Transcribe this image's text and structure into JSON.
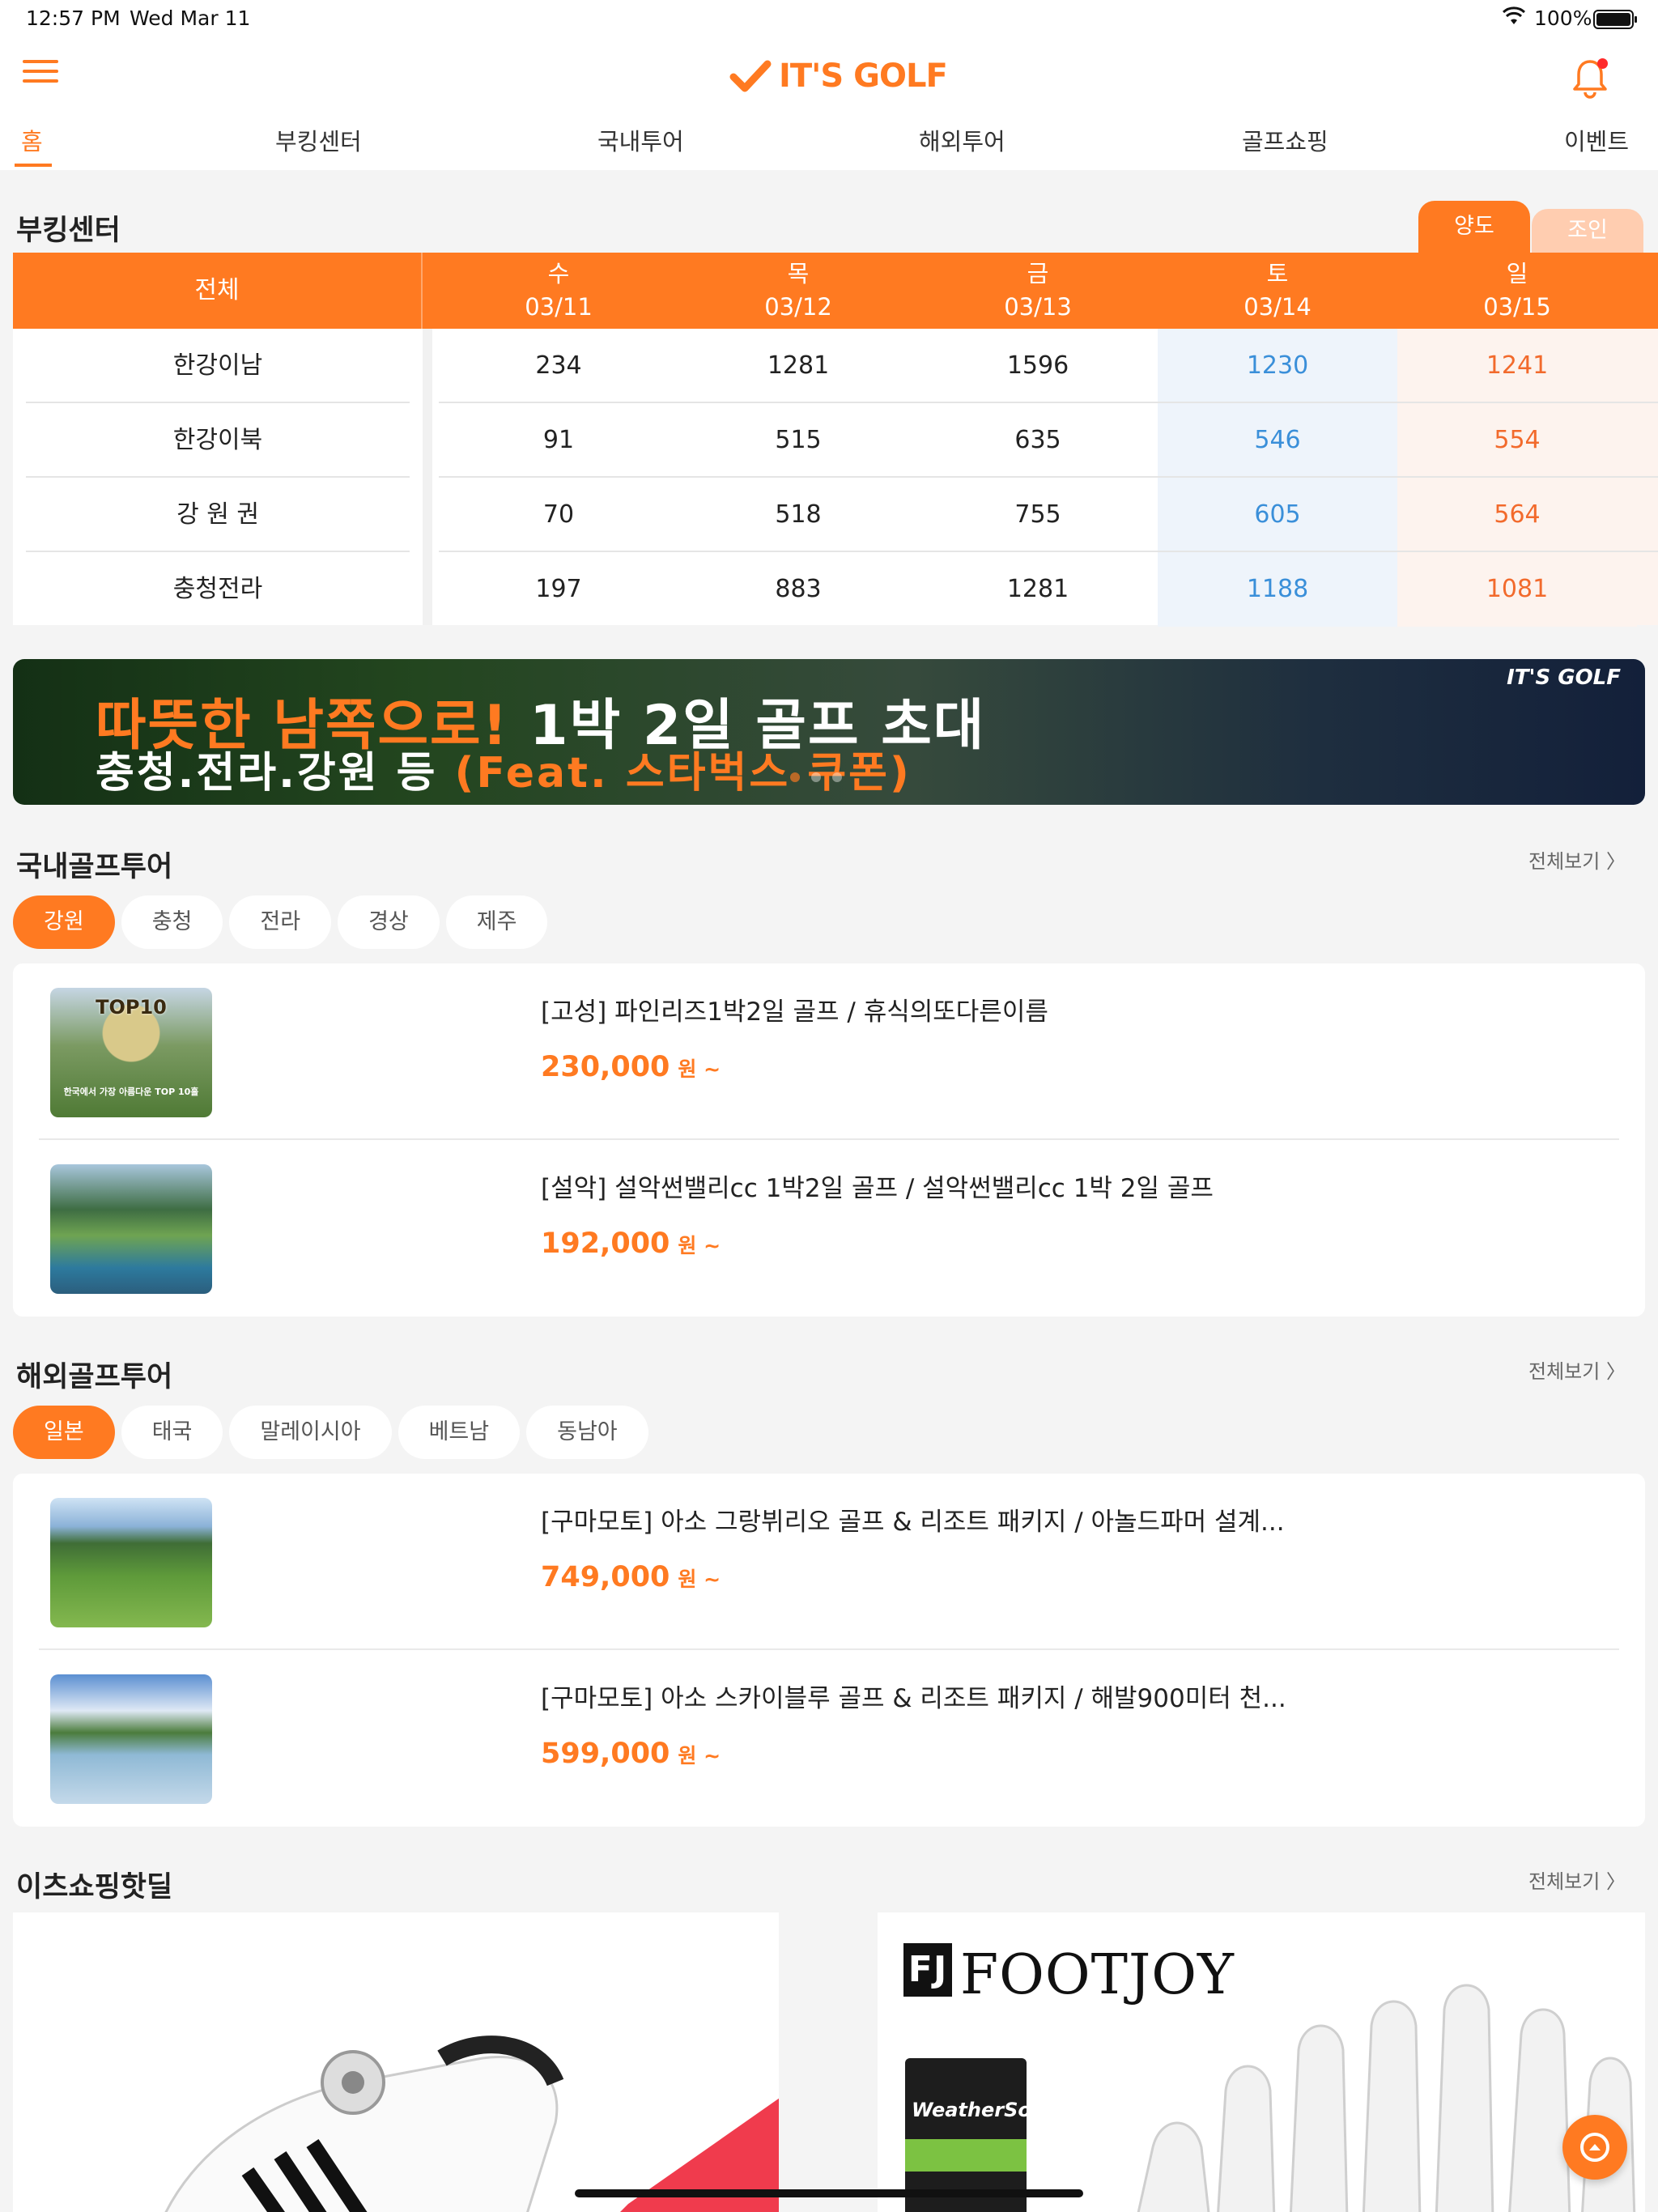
{
  "status_bar": {
    "time": "12:57 PM",
    "date": "Wed Mar 11",
    "battery": "100%"
  },
  "header": {
    "logo": "IT'S GOLF"
  },
  "nav": {
    "tabs": [
      "홈",
      "부킹센터",
      "국내투어",
      "해외투어",
      "골프쇼핑",
      "이벤트"
    ]
  },
  "booking": {
    "title": "부킹센터",
    "toggle": [
      "양도",
      "조인"
    ],
    "all_label": "전체",
    "days": [
      {
        "dow": "수",
        "date": "03/11"
      },
      {
        "dow": "목",
        "date": "03/12"
      },
      {
        "dow": "금",
        "date": "03/13"
      },
      {
        "dow": "토",
        "date": "03/14"
      },
      {
        "dow": "일",
        "date": "03/15"
      }
    ],
    "rows": [
      {
        "region": "한강이남",
        "values": [
          "234",
          "1281",
          "1596",
          "1230",
          "1241"
        ]
      },
      {
        "region": "한강이북",
        "values": [
          "91",
          "515",
          "635",
          "546",
          "554"
        ]
      },
      {
        "region": "강 원 권",
        "values": [
          "70",
          "518",
          "755",
          "605",
          "564"
        ]
      },
      {
        "region": "충청전라",
        "values": [
          "197",
          "883",
          "1281",
          "1188",
          "1081"
        ]
      }
    ]
  },
  "banner": {
    "logo": "IT'S GOLF",
    "line1_a": "따뜻한 남쪽으로!",
    "line1_b": "1박 2일 골프 초대",
    "line2_a": "충청.전라.강원 등",
    "line2_b": "(Feat. 스타벅스 쿠폰)"
  },
  "domestic": {
    "title": "국내골프투어",
    "more": "전체보기 〉",
    "filters": [
      "강원",
      "충청",
      "전라",
      "경상",
      "제주"
    ],
    "items": [
      {
        "title": "[고성] 파인리즈1박2일 골프 / 휴식의또다른이름",
        "price": "230,000",
        "unit": "원 ~",
        "thumb_text": "TOP10",
        "thumb_caption": "한국에서 가장 아름다운 TOP 10홀"
      },
      {
        "title": "[설악] 설악썬밸리cc 1박2일 골프 / 설악썬밸리cc 1박 2일 골프",
        "price": "192,000",
        "unit": "원 ~"
      }
    ]
  },
  "overseas": {
    "title": "해외골프투어",
    "more": "전체보기 〉",
    "filters": [
      "일본",
      "태국",
      "말레이시아",
      "베트남",
      "동남아"
    ],
    "items": [
      {
        "title": "[구마모토] 아소 그랑뷔리오 골프 & 리조트 패키지 / 아놀드파머 설계...",
        "price": "749,000",
        "unit": "원 ~"
      },
      {
        "title": "[구마모토] 아소 스카이블루 골프 & 리조트 패키지 / 해발900미터 천...",
        "price": "599,000",
        "unit": "원 ~"
      }
    ]
  },
  "shopping": {
    "title": "이츠쇼핑핫딜",
    "more": "전체보기 〉",
    "brand": "FOOTJOY",
    "brand_mark": "FJ",
    "product_label": "WeatherSof"
  },
  "colors": {
    "accent": "#ff7a21",
    "saturday": "#3a8fd9",
    "sunday": "#f26a2c"
  }
}
